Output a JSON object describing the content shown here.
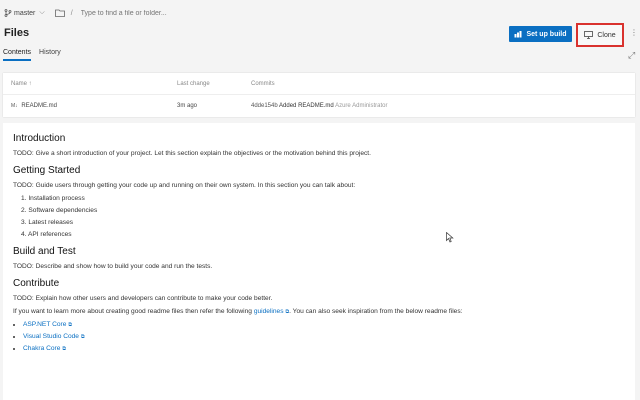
{
  "topbar": {
    "branch": "master",
    "path_placeholder": "Type to find a file or folder..."
  },
  "header": {
    "title": "Files",
    "setup_build_label": "Set up build",
    "clone_label": "Clone"
  },
  "tabs": [
    {
      "label": "Contents",
      "active": true
    },
    {
      "label": "History",
      "active": false
    }
  ],
  "table": {
    "headers": {
      "name": "Name ↑",
      "last_change": "Last change",
      "commits": "Commits"
    },
    "rows": [
      {
        "name": "README.md",
        "last_change": "3m ago",
        "commit_id": "4dde154b",
        "commit_msg": "Added README.md",
        "author": "Azure Administrator"
      }
    ]
  },
  "readme": {
    "intro_title": "Introduction",
    "intro_text": "TODO: Give a short introduction of your project. Let this section explain the objectives or the motivation behind this project.",
    "gs_title": "Getting Started",
    "gs_text": "TODO: Guide users through getting your code up and running on their own system. In this section you can talk about:",
    "gs_list": [
      "1. Installation process",
      "2. Software dependencies",
      "3. Latest releases",
      "4. API references"
    ],
    "bt_title": "Build and Test",
    "bt_text": "TODO: Describe and show how to build your code and run the tests.",
    "contrib_title": "Contribute",
    "contrib_text": "TODO: Explain how other users and developers can contribute to make your code better.",
    "contrib_text2_a": "If you want to learn more about creating good readme files then refer the following",
    "contrib_link": "guidelines",
    "contrib_text2_b": ". You can also seek inspiration from the below readme files:",
    "links": [
      "ASP.NET Core",
      "Visual Studio Code",
      "Chakra Core"
    ]
  },
  "colors": {
    "accent": "#0a6fc2",
    "highlight": "#d9322e"
  }
}
